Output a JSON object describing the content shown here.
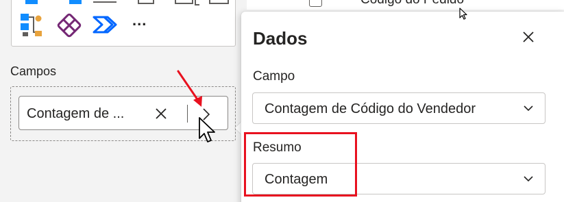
{
  "visualizations": {
    "more_label": "...",
    "icons": [
      "table-icon",
      "matrix-icon",
      "card-icon",
      "slicer-icon",
      "kpi-icon",
      "multi-row-card-icon",
      "decomposition-tree-icon",
      "power-apps-icon",
      "power-automate-icon"
    ]
  },
  "fields_pane": {
    "label": "Campos",
    "pill": {
      "text": "Contagem de ...",
      "remove_icon": "close-icon",
      "expand_icon": "chevron-right-icon"
    }
  },
  "background_table": {
    "header_text": "Código do Pedido"
  },
  "popup": {
    "title": "Dados",
    "close_icon": "close-icon",
    "campo": {
      "label": "Campo",
      "value": "Contagem de Código do Vendedor"
    },
    "resumo": {
      "label": "Resumo",
      "value": "Contagem"
    }
  },
  "annotations": {
    "highlight_color": "#e8111f",
    "arrow_color": "#e8111f"
  },
  "colors": {
    "accent_power_apps": "#742774",
    "accent_power_automate": "#0066ff",
    "decomp_orange": "#e8a33d",
    "viz_blue": "#118dff"
  }
}
